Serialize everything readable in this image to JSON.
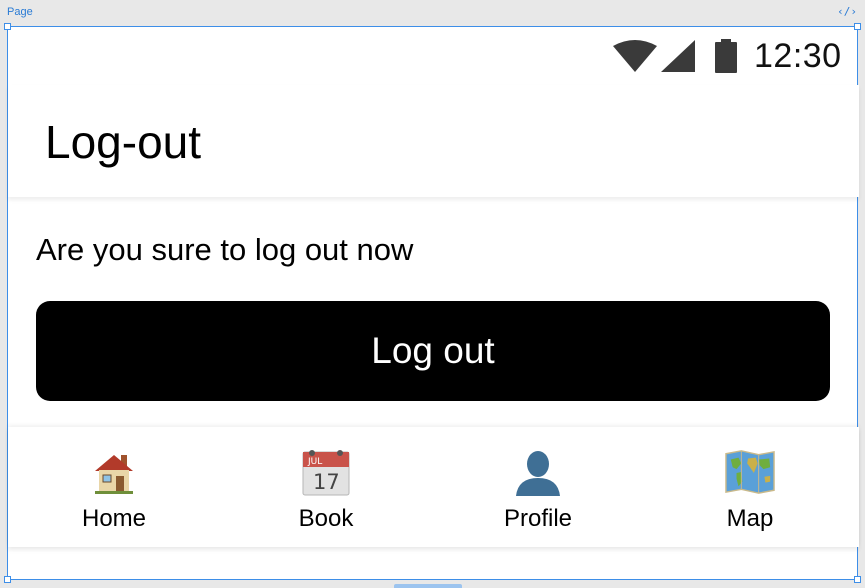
{
  "editor": {
    "page_label": "Page",
    "code_label": "‹/›"
  },
  "status_bar": {
    "time": "12:30"
  },
  "header": {
    "title": "Log-out"
  },
  "main": {
    "prompt": "Are you sure to log out now",
    "logout_label": "Log out"
  },
  "calendar_icon": {
    "month": "JUL",
    "day": "17"
  },
  "nav": {
    "items": [
      {
        "label": "Home",
        "icon": "house-icon"
      },
      {
        "label": "Book",
        "icon": "calendar-icon"
      },
      {
        "label": "Profile",
        "icon": "person-icon"
      },
      {
        "label": "Map",
        "icon": "world-map-icon"
      }
    ]
  },
  "colors": {
    "button_bg": "#000000",
    "button_text": "#ffffff",
    "selection": "#3d8ee8"
  }
}
